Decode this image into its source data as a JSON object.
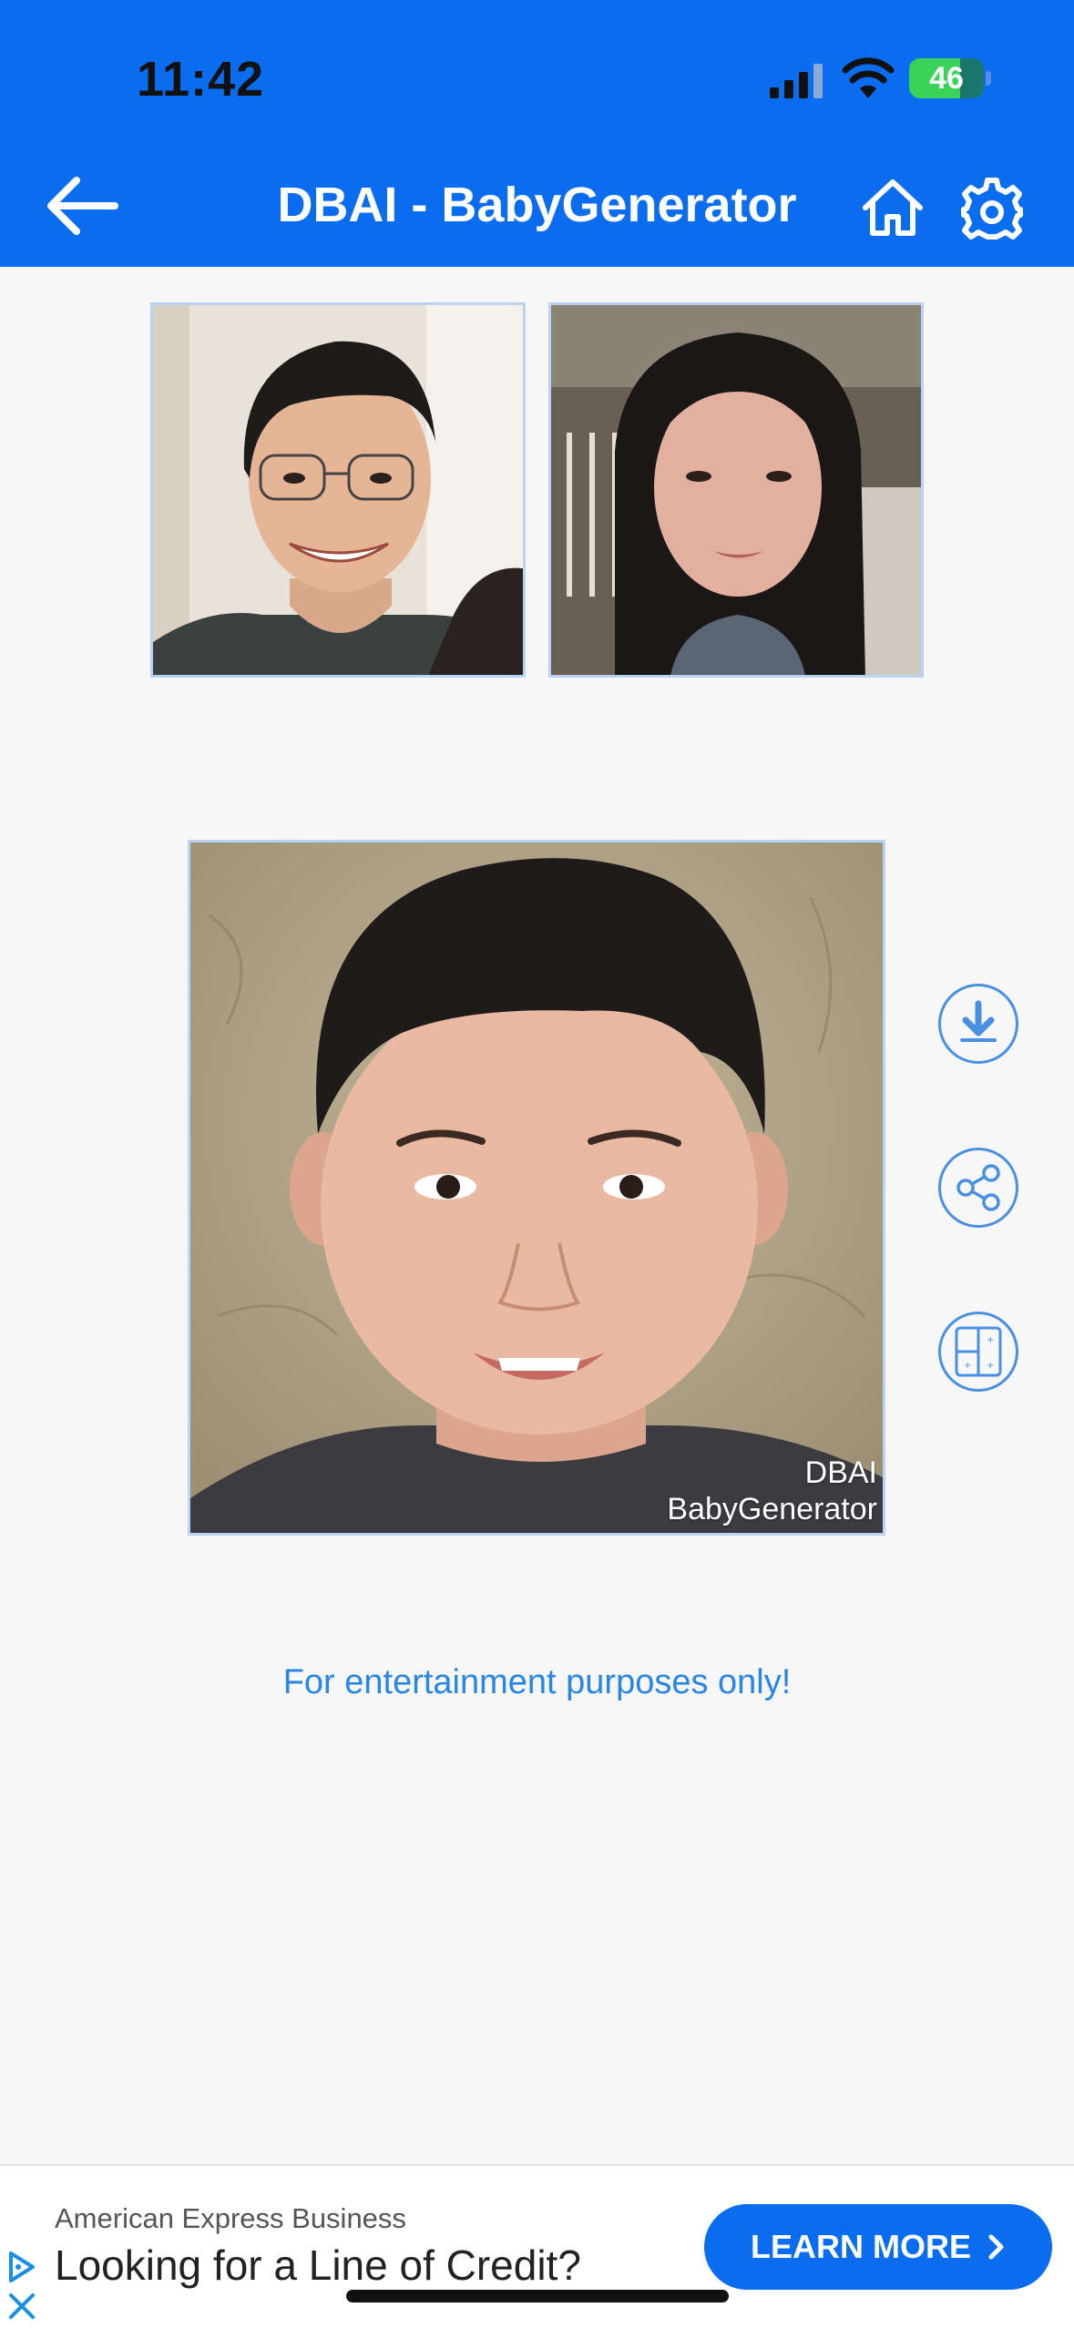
{
  "status_bar": {
    "time": "11:42",
    "battery": "46"
  },
  "header": {
    "title": "DBAI - BabyGenerator"
  },
  "result": {
    "watermark_line1": "DBAI",
    "watermark_line2": "BabyGenerator"
  },
  "notice": "For entertainment purposes only!",
  "ad": {
    "sponsor": "American Express Business",
    "headline": "Looking for a Line of Credit?",
    "cta": "LEARN MORE"
  },
  "colors": {
    "header": "#0a6df0",
    "accent": "#4a90e2",
    "notice": "#2a86e6"
  }
}
